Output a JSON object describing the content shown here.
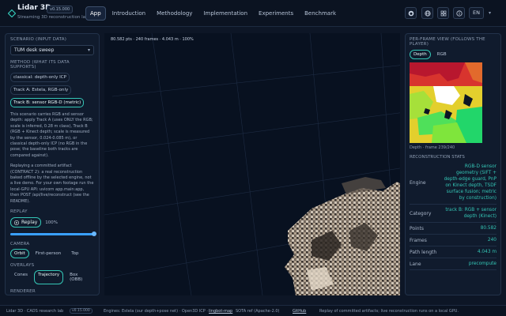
{
  "header": {
    "title": "Lidar 3D",
    "version": "v0.15.000",
    "subtitle": "Streaming 3D reconstruction lab",
    "tabs": [
      {
        "label": "App",
        "active": true
      },
      {
        "label": "Introduction",
        "active": false
      },
      {
        "label": "Methodology",
        "active": false
      },
      {
        "label": "Implementation",
        "active": false
      },
      {
        "label": "Experiments",
        "active": false
      },
      {
        "label": "Benchmark",
        "active": false
      }
    ],
    "icon_buttons": [
      "github-icon",
      "globe-icon",
      "grid-icon",
      "info-icon"
    ],
    "language": "EN",
    "accent_color": "#34c6b6"
  },
  "left_panel": {
    "scenario_label": "SCENARIO (INPUT DATA)",
    "scenario_value": "TUM desk sweep",
    "method_label": "METHOD (WHAT ITS DATA SUPPORTS)",
    "methods": [
      {
        "label": "classical: depth-only ICP",
        "active": false
      },
      {
        "label": "Track A: Estela, RGB-only",
        "active": false
      },
      {
        "label": "Track B: sensor RGB-D (metric)",
        "active": true
      }
    ],
    "description_1": "This scenario carries RGB and sensor depth: apply Track A (uses ONLY the RGB; scale is inferred, 0.28 m class), Track B (RGB + Kinect depth; scale is measured by the sensor, 0.024-0.085 m), or classical depth-only ICP (no RGB in the pose; the baseline both tracks are compared against).",
    "description_2": "Replaying a committed artifact (CONTRACT 2): a real reconstruction baked offline by the selected engine, not a live demo. For your own footage run the local-GPU API: uvicorn app.main:app, then POST /api/live/reconstruct (see the README).",
    "replay_label": "REPLAY",
    "replay_button": "Replay",
    "replay_speed": "100%",
    "progress": 1.0,
    "camera_label": "CAMERA",
    "camera_options": [
      {
        "label": "Orbit",
        "active": true
      },
      {
        "label": "First-person",
        "active": false
      },
      {
        "label": "Top",
        "active": false
      }
    ],
    "overlays_label": "OVERLAYS",
    "overlay_options": [
      {
        "label": "Cones",
        "active": false
      },
      {
        "label": "Trajectory",
        "active": true
      },
      {
        "label": "Box (OBB)",
        "active": false
      }
    ],
    "renderer_label": "RENDERER"
  },
  "viewport": {
    "readout": "80.582 pts · 240 frames · 4.043 m · 100%"
  },
  "right_panel": {
    "title": "PER-FRAME VIEW (FOLLOWS THE PLAYER)",
    "toggles": [
      {
        "label": "Depth",
        "active": true
      },
      {
        "label": "RGB",
        "active": false
      }
    ],
    "caption": "Depth · frame 239/240",
    "stats_title": "RECONSTRUCTION STATS",
    "stats": [
      {
        "key": "Engine",
        "value": "RGB-D sensor geometry (SIFT + depth-edge guard, PnP on Kinect depth, TSDF surface fusion; metric by construction)"
      },
      {
        "key": "Category",
        "value": "track B: RGB + sensor depth (Kinect)"
      },
      {
        "key": "Points",
        "value": "80.582"
      },
      {
        "key": "Frames",
        "value": "240"
      },
      {
        "key": "Path length",
        "value": "4.043 m"
      },
      {
        "key": "Lane",
        "value": "precompute"
      }
    ]
  },
  "footer": {
    "lab": "Lidar 3D · CAOS research lab",
    "version": "v0.15.000",
    "engines": "Engines: Estela (our depth+pose net) · Open3D ICP ·",
    "link_1": "lingbot-map",
    "sota": "SOTA ref (Apache-2.0)",
    "link_2": "GitHub",
    "note": "Replay of committed artifacts; live reconstruction runs on a local GPU."
  }
}
